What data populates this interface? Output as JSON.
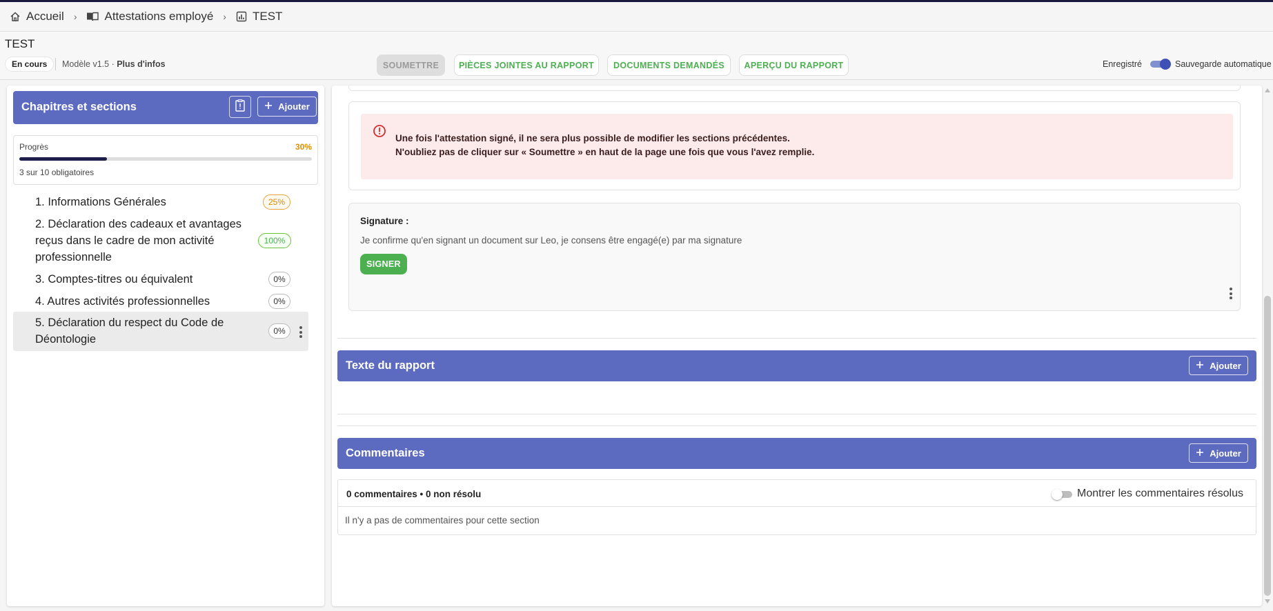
{
  "breadcrumb": {
    "items": [
      {
        "label": "Accueil",
        "icon": "home-icon"
      },
      {
        "label": "Attestations employé",
        "icon": "book-icon"
      },
      {
        "label": "TEST",
        "icon": "report-icon"
      }
    ],
    "separator": "›"
  },
  "header": {
    "title": "TEST",
    "status": "En cours",
    "model": "Modèle v1.5 ·",
    "more_info": "Plus d'infos",
    "buttons": {
      "submit": "SOUMETTRE",
      "attachments": "PIÈCES JOINTES AU RAPPORT",
      "requested_docs": "DOCUMENTS DEMANDÉS",
      "preview": "APERÇU DU RAPPORT"
    },
    "saved_label": "Enregistré",
    "autosave_label": "Sauvegarde automatique",
    "autosave_on": true
  },
  "sidebar": {
    "title": "Chapitres et sections",
    "add_label": "Ajouter",
    "progress": {
      "label": "Progrès",
      "percent_label": "30%",
      "value": 0.3,
      "count_label": "3 sur 10 obligatoires"
    },
    "chapters": [
      {
        "label": "1. Informations Générales",
        "badge": "25%",
        "badge_style": "orange"
      },
      {
        "label": "2. Déclaration des cadeaux et avantages reçus dans le cadre de mon activité professionnelle",
        "badge": "100%",
        "badge_style": "green"
      },
      {
        "label": "3. Comptes-titres ou équivalent",
        "badge": "0%",
        "badge_style": "neutral"
      },
      {
        "label": "4. Autres activités professionnelles",
        "badge": "0%",
        "badge_style": "neutral"
      },
      {
        "label": "5. Déclaration du respect du Code de Déontologie",
        "badge": "0%",
        "badge_style": "neutral",
        "selected": true
      }
    ]
  },
  "main": {
    "warning": {
      "line1": "Une fois l'attestation signé, il ne sera plus possible de modifier les sections précédentes.",
      "line2": "N'oubliez pas de cliquer sur « Soumettre » en haut de la page une fois que vous l'avez remplie."
    },
    "signature": {
      "label": "Signature :",
      "text": "Je confirme qu'en signant un document sur Leo, je consens être engagé(e) par ma signature",
      "button": "SIGNER"
    },
    "report_text": {
      "title": "Texte du rapport",
      "add_label": "Ajouter"
    },
    "comments": {
      "title": "Commentaires",
      "add_label": "Ajouter",
      "counts": "0 commentaires • 0 non résolu",
      "show_resolved": "Montrer les commentaires résolus",
      "show_resolved_on": false,
      "empty": "Il n'y a pas de commentaires pour cette section"
    }
  },
  "colors": {
    "accent": "#5c6bc0",
    "green": "#4caf50",
    "orange": "#e09000",
    "alert_bg": "#fdeaea"
  }
}
